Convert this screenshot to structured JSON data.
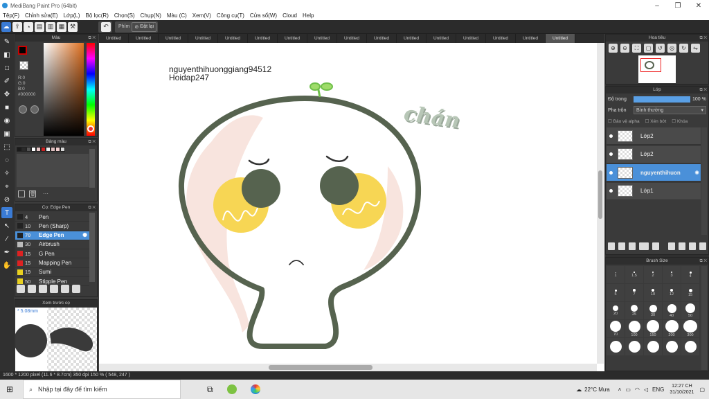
{
  "window": {
    "title": "MediBang Paint Pro (64bit)",
    "minimize_icon": "minimize-icon",
    "maximize_icon": "maximize-icon",
    "close_icon": "close-icon"
  },
  "menu": [
    "Tệp(F)",
    "Chỉnh sửa(E)",
    "Lớp(L)",
    "Bộ lọc(R)",
    "Chọn(S)",
    "Chụp(N)",
    "Màu (C)",
    "Xem(V)",
    "Công cụ(T)",
    "Cửa sổ(W)",
    "Cloud",
    "Help"
  ],
  "toolbar": {
    "phim_label": "Phím",
    "reset_label": "Đặt lại"
  },
  "color_panel": {
    "title": "Màu",
    "r": "R:0",
    "g": "G:0",
    "b": "B:0",
    "hex": "#000000"
  },
  "palette_panel": {
    "title": "Bảng màu",
    "colors": [
      "#1a1a1a",
      "#2a2a2a",
      "#555555",
      "#ffffff",
      "#e8c8c8",
      "#cc2222",
      "#f0f0f0",
      "#e0c0c0",
      "#f4d0d0",
      "#d8d8d8"
    ],
    "more": "···"
  },
  "brush_panel": {
    "title": "Cọ: Edge Pen",
    "items": [
      {
        "size": "4",
        "name": "Pen",
        "color": "#222222"
      },
      {
        "size": "10",
        "name": "Pen (Sharp)",
        "color": "#222222"
      },
      {
        "size": "70",
        "name": "Edge Pen",
        "color": "#222222"
      },
      {
        "size": "30",
        "name": "Airbrush",
        "color": "#bbbbbb"
      },
      {
        "size": "15",
        "name": "G Pen",
        "color": "#dd2222"
      },
      {
        "size": "15",
        "name": "Mapping Pen",
        "color": "#dd2222"
      },
      {
        "size": "19",
        "name": "Sumi",
        "color": "#e8d020"
      },
      {
        "size": "50",
        "name": "Stipple Pen",
        "color": "#e8d020"
      }
    ]
  },
  "preview_panel": {
    "title": "Xem trước cọ",
    "size": "5.08mm"
  },
  "tabs": [
    "Untitled",
    "Untitled",
    "Untitled",
    "Untitled",
    "Untitled",
    "Untitled",
    "Untitled",
    "Untitled",
    "Untitled",
    "Untitled",
    "Untitled",
    "Untitled",
    "Untitled",
    "Untitled",
    "Untitled",
    "Untitled"
  ],
  "canvas": {
    "watermark_line1": "nguyenthihuonggiang94512",
    "watermark_line2": "Hoidap247",
    "text_chan": "chán"
  },
  "navigator": {
    "title": "Hoa tiêu"
  },
  "layer_panel": {
    "title": "Lớp",
    "opacity_label": "Độ trong",
    "opacity_value": "100 %",
    "opacity_fraction": 1.0,
    "blend_label": "Pha trộn",
    "blend_value": "Bình thường",
    "protect_alpha": "Bảo vệ alpha",
    "clipping": "Xén bớt",
    "lock": "Khóa",
    "layers": [
      {
        "name": "Lớp2",
        "selected": false
      },
      {
        "name": "Lớp2",
        "selected": false
      },
      {
        "name": "nguyenthihuon",
        "selected": true
      },
      {
        "name": "Lớp1",
        "selected": false
      }
    ]
  },
  "brush_size_panel": {
    "title": "Brush Size",
    "sizes": [
      "1",
      "1.5",
      "2",
      "3",
      "4",
      "5",
      "7",
      "10",
      "12",
      "15",
      "20",
      "25",
      "30",
      "40",
      "50",
      "70",
      "100",
      "150",
      "200",
      "300",
      "",
      "",
      "",
      "",
      ""
    ]
  },
  "status": {
    "text": "1600 * 1200 pixel   (11.6 * 8.7cm)   350 dpi   150 %   ( 548, 247 )"
  },
  "taskbar": {
    "search_placeholder": "Nhập tại đây để tìm kiếm",
    "weather": "22°C  Mưa",
    "lang": "ENG",
    "time": "12:27 CH",
    "date": "31/10/2021"
  }
}
